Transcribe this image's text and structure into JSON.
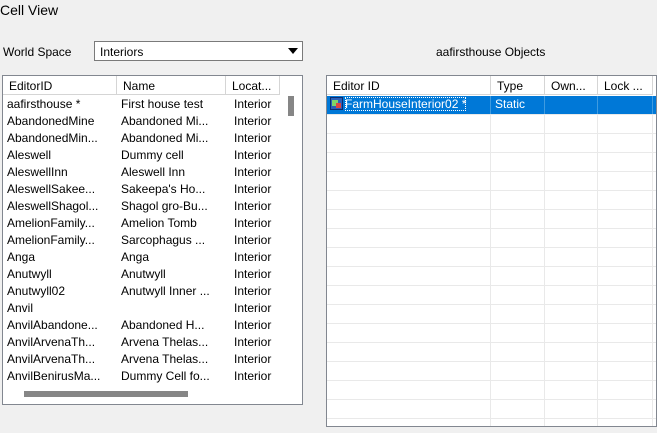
{
  "window": {
    "title": "Cell View"
  },
  "world_space": {
    "label": "World Space",
    "value": "Interiors"
  },
  "cells": {
    "columns": [
      "EditorID",
      "Name",
      "Locat..."
    ],
    "rows": [
      [
        "aafirsthouse *",
        "First house test",
        "Interior"
      ],
      [
        "AbandonedMine",
        "Abandoned Mi...",
        "Interior"
      ],
      [
        "AbandonedMin...",
        "Abandoned Mi...",
        "Interior"
      ],
      [
        "Aleswell",
        "Dummy cell",
        "Interior"
      ],
      [
        "AleswellInn",
        "Aleswell Inn",
        "Interior"
      ],
      [
        "AleswellSakee...",
        "Sakeepa's Ho...",
        "Interior"
      ],
      [
        "AleswellShagol...",
        "Shagol gro-Bu...",
        "Interior"
      ],
      [
        "AmelionFamily...",
        "Amelion Tomb",
        "Interior"
      ],
      [
        "AmelionFamily...",
        "Sarcophagus ...",
        "Interior"
      ],
      [
        "Anga",
        "Anga",
        "Interior"
      ],
      [
        "Anutwyll",
        "Anutwyll",
        "Interior"
      ],
      [
        "Anutwyll02",
        "Anutwyll Inner ...",
        "Interior"
      ],
      [
        "Anvil",
        "",
        "Interior"
      ],
      [
        "AnvilAbandone...",
        "Abandoned H...",
        "Interior"
      ],
      [
        "AnvilArvenaTh...",
        "Arvena Thelas...",
        "Interior"
      ],
      [
        "AnvilArvenaTh...",
        "Arvena Thelas...",
        "Interior"
      ],
      [
        "AnvilBenirusMa...",
        "Dummy Cell fo...",
        "Interior"
      ]
    ]
  },
  "objects": {
    "title": "aafirsthouse Objects",
    "columns": [
      "Editor ID",
      "Type",
      "Own...",
      "Lock ..."
    ],
    "rows": [
      [
        "FarmHouseInterior02 *",
        "Static",
        "",
        ""
      ]
    ],
    "empty_rows": 17,
    "icon": "static-object-icon"
  },
  "colors": {
    "selection": "#0078d7",
    "window_bg": "#f0f0f0"
  }
}
